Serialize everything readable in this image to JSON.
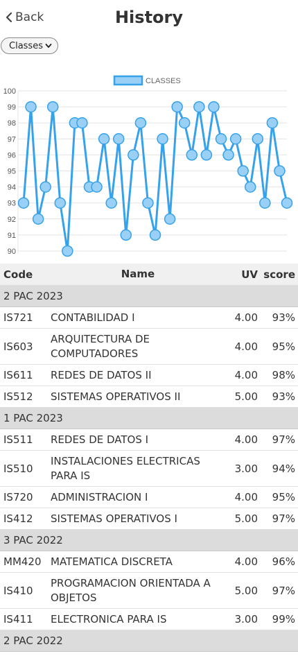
{
  "header": {
    "back_label": "Back",
    "title": "History"
  },
  "filter": {
    "selected": "Classes"
  },
  "chart_data": {
    "type": "line",
    "legend": [
      "CLASSES"
    ],
    "ylim": [
      90,
      100
    ],
    "yticks": [
      90,
      91,
      92,
      93,
      94,
      95,
      96,
      97,
      98,
      99,
      100
    ],
    "grid": true,
    "series": [
      {
        "name": "CLASSES",
        "color": "#36a2eb",
        "fill": "#9ad0f5",
        "values": [
          93,
          99,
          92,
          94,
          99,
          93,
          90,
          98,
          98,
          94,
          94,
          97,
          93,
          97,
          91,
          96,
          98,
          93,
          91,
          97,
          92,
          99,
          98,
          96,
          99,
          96,
          99,
          97,
          96,
          97,
          95,
          94,
          97,
          93,
          98,
          95,
          93
        ]
      }
    ]
  },
  "table": {
    "headers": {
      "code": "Code",
      "name": "Name",
      "uv": "UV",
      "score": "score"
    },
    "sections": [
      {
        "title": "2 PAC 2023",
        "rows": [
          {
            "code": "IS721",
            "name": "CONTABILIDAD I",
            "uv": "4.00",
            "score": "93%"
          },
          {
            "code": "IS603",
            "name": "ARQUITECTURA DE COMPUTADORES",
            "uv": "4.00",
            "score": "95%"
          },
          {
            "code": "IS611",
            "name": "REDES DE DATOS II",
            "uv": "4.00",
            "score": "98%"
          },
          {
            "code": "IS512",
            "name": "SISTEMAS OPERATIVOS II",
            "uv": "5.00",
            "score": "93%"
          }
        ]
      },
      {
        "title": "1 PAC 2023",
        "rows": [
          {
            "code": "IS511",
            "name": "REDES DE DATOS I",
            "uv": "4.00",
            "score": "97%"
          },
          {
            "code": "IS510",
            "name": "INSTALACIONES ELECTRICAS PARA IS",
            "uv": "3.00",
            "score": "94%"
          },
          {
            "code": "IS720",
            "name": "ADMINISTRACION I",
            "uv": "4.00",
            "score": "95%"
          },
          {
            "code": "IS412",
            "name": "SISTEMAS OPERATIVOS I",
            "uv": "5.00",
            "score": "97%"
          }
        ]
      },
      {
        "title": "3 PAC 2022",
        "rows": [
          {
            "code": "MM420",
            "name": "MATEMATICA DISCRETA",
            "uv": "4.00",
            "score": "96%"
          },
          {
            "code": "IS410",
            "name": "PROGRAMACION ORIENTADA A OBJETOS",
            "uv": "5.00",
            "score": "97%"
          },
          {
            "code": "IS411",
            "name": "ELECTRONICA PARA IS",
            "uv": "3.00",
            "score": "99%"
          }
        ]
      },
      {
        "title": "2 PAC 2022",
        "rows": []
      }
    ]
  }
}
